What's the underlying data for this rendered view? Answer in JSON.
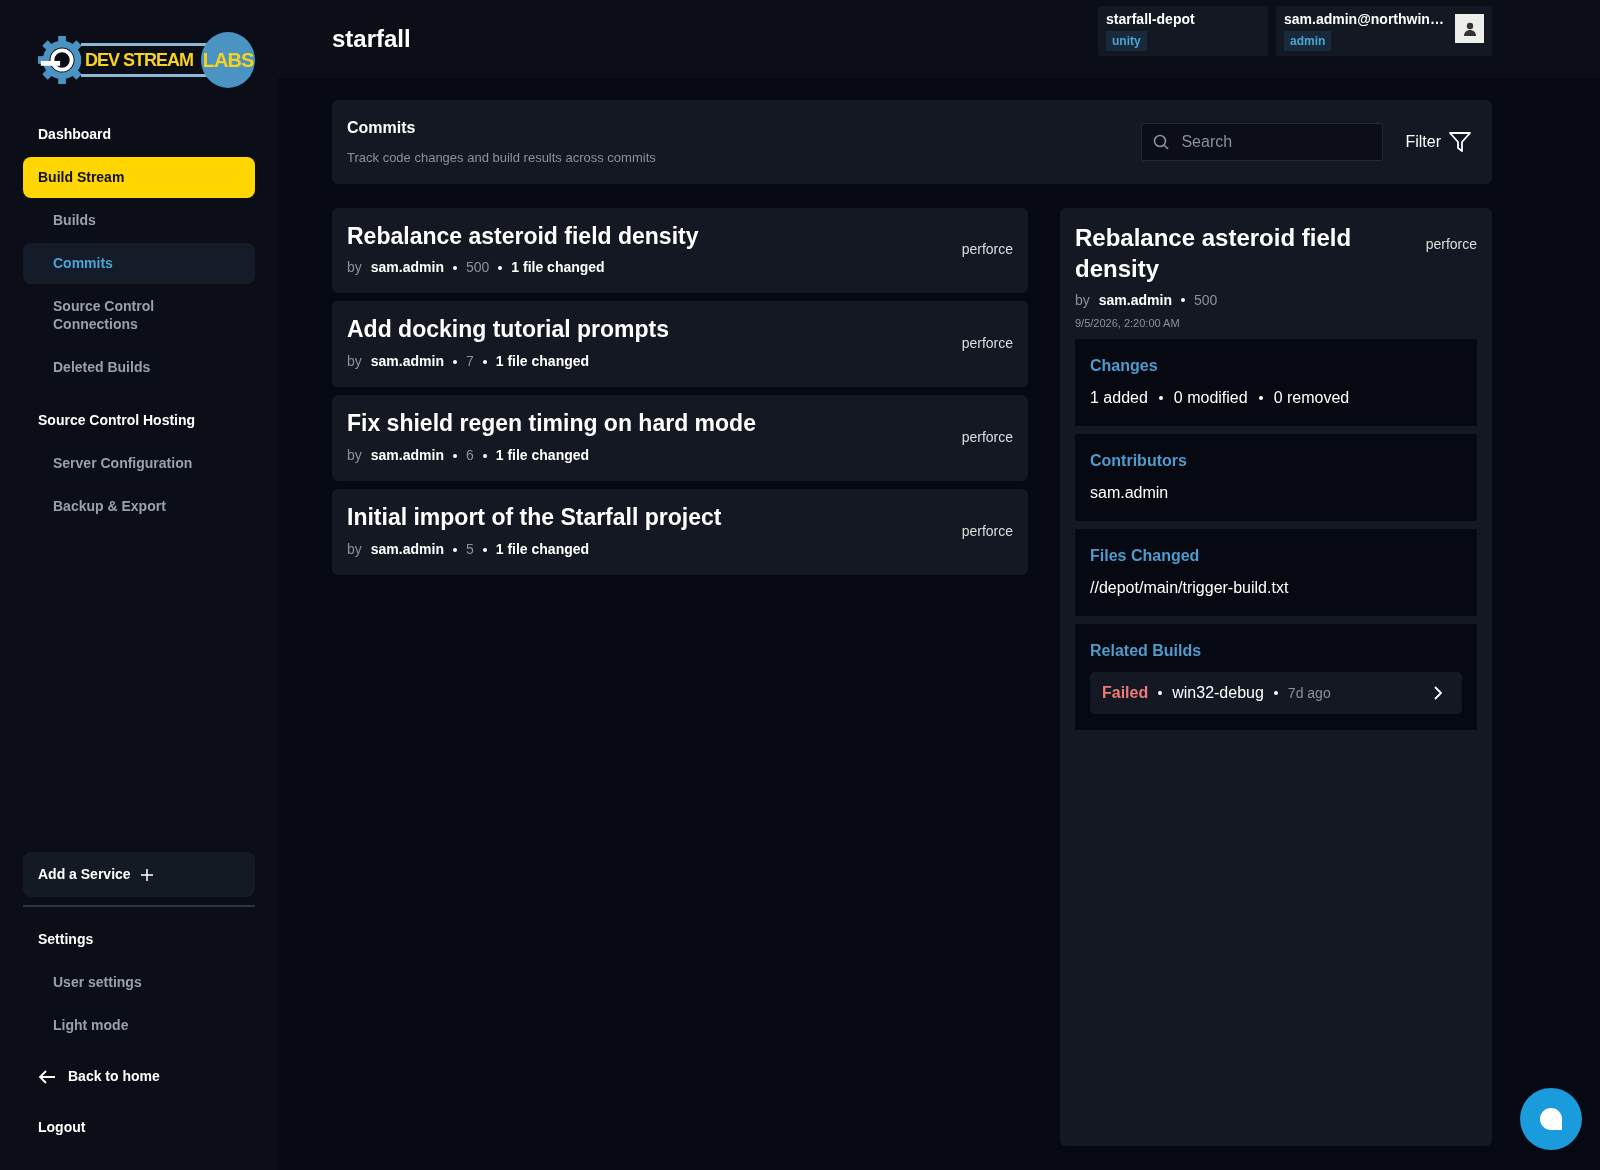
{
  "logo": {
    "primary": "DEV STREAM",
    "secondary": "LABS"
  },
  "nav": [
    {
      "label": "Dashboard",
      "kind": "section",
      "selected": false
    },
    {
      "label": "Build Stream",
      "kind": "section",
      "selected": true
    },
    {
      "label": "Builds",
      "kind": "sub",
      "selected": false
    },
    {
      "label": "Commits",
      "kind": "sub",
      "selected": true
    },
    {
      "label": "Source Control Connections",
      "kind": "sub",
      "selected": false
    },
    {
      "label": "Deleted Builds",
      "kind": "sub",
      "selected": false
    },
    {
      "label": "Source Control Hosting",
      "kind": "section",
      "selected": false
    },
    {
      "label": "Server Configuration",
      "kind": "sub",
      "selected": false
    },
    {
      "label": "Backup & Export",
      "kind": "sub",
      "selected": false
    }
  ],
  "add_service": {
    "label": "Add a Service"
  },
  "settings_nav": [
    {
      "label": "Settings",
      "kind": "section"
    },
    {
      "label": "User settings",
      "kind": "sub"
    },
    {
      "label": "Light mode",
      "kind": "sub"
    }
  ],
  "back_link": "Back to home",
  "logout": "Logout",
  "header": {
    "title": "starfall",
    "project": {
      "name": "starfall-depot",
      "tag": "unity"
    },
    "user": {
      "email": "sam.admin@northwin…",
      "role": "admin"
    }
  },
  "commits_panel": {
    "title": "Commits",
    "subtitle": "Track code changes and build results across commits",
    "search": {
      "placeholder": "Search"
    },
    "filter": "Filter"
  },
  "commits": [
    {
      "title": "Rebalance asteroid field density",
      "by": "by",
      "author": "sam.admin",
      "change": "500",
      "files": "1 file changed",
      "vcs": "perforce"
    },
    {
      "title": "Add docking tutorial prompts",
      "by": "by",
      "author": "sam.admin",
      "change": "7",
      "files": "1 file changed",
      "vcs": "perforce"
    },
    {
      "title": "Fix shield regen timing on hard mode",
      "by": "by",
      "author": "sam.admin",
      "change": "6",
      "files": "1 file changed",
      "vcs": "perforce"
    },
    {
      "title": "Initial import of the Starfall project",
      "by": "by",
      "author": "sam.admin",
      "change": "5",
      "files": "1 file changed",
      "vcs": "perforce"
    }
  ],
  "detail": {
    "title": "Rebalance asteroid field density",
    "vcs": "perforce",
    "by": "by",
    "author": "sam.admin",
    "change": "500",
    "date": "9/5/2026, 2:20:00 AM",
    "sections": [
      {
        "kind": "changes",
        "heading": "Changes",
        "items": [
          "1 added",
          "0 modified",
          "0 removed"
        ]
      },
      {
        "kind": "text",
        "heading": "Contributors",
        "text": "sam.admin"
      },
      {
        "kind": "text",
        "heading": "Files Changed",
        "text": "//depot/main/trigger-build.txt"
      },
      {
        "kind": "builds",
        "heading": "Related Builds",
        "builds": [
          {
            "status": "Failed",
            "failed": true,
            "name": "win32-debug",
            "age": "7d ago"
          }
        ]
      }
    ]
  }
}
